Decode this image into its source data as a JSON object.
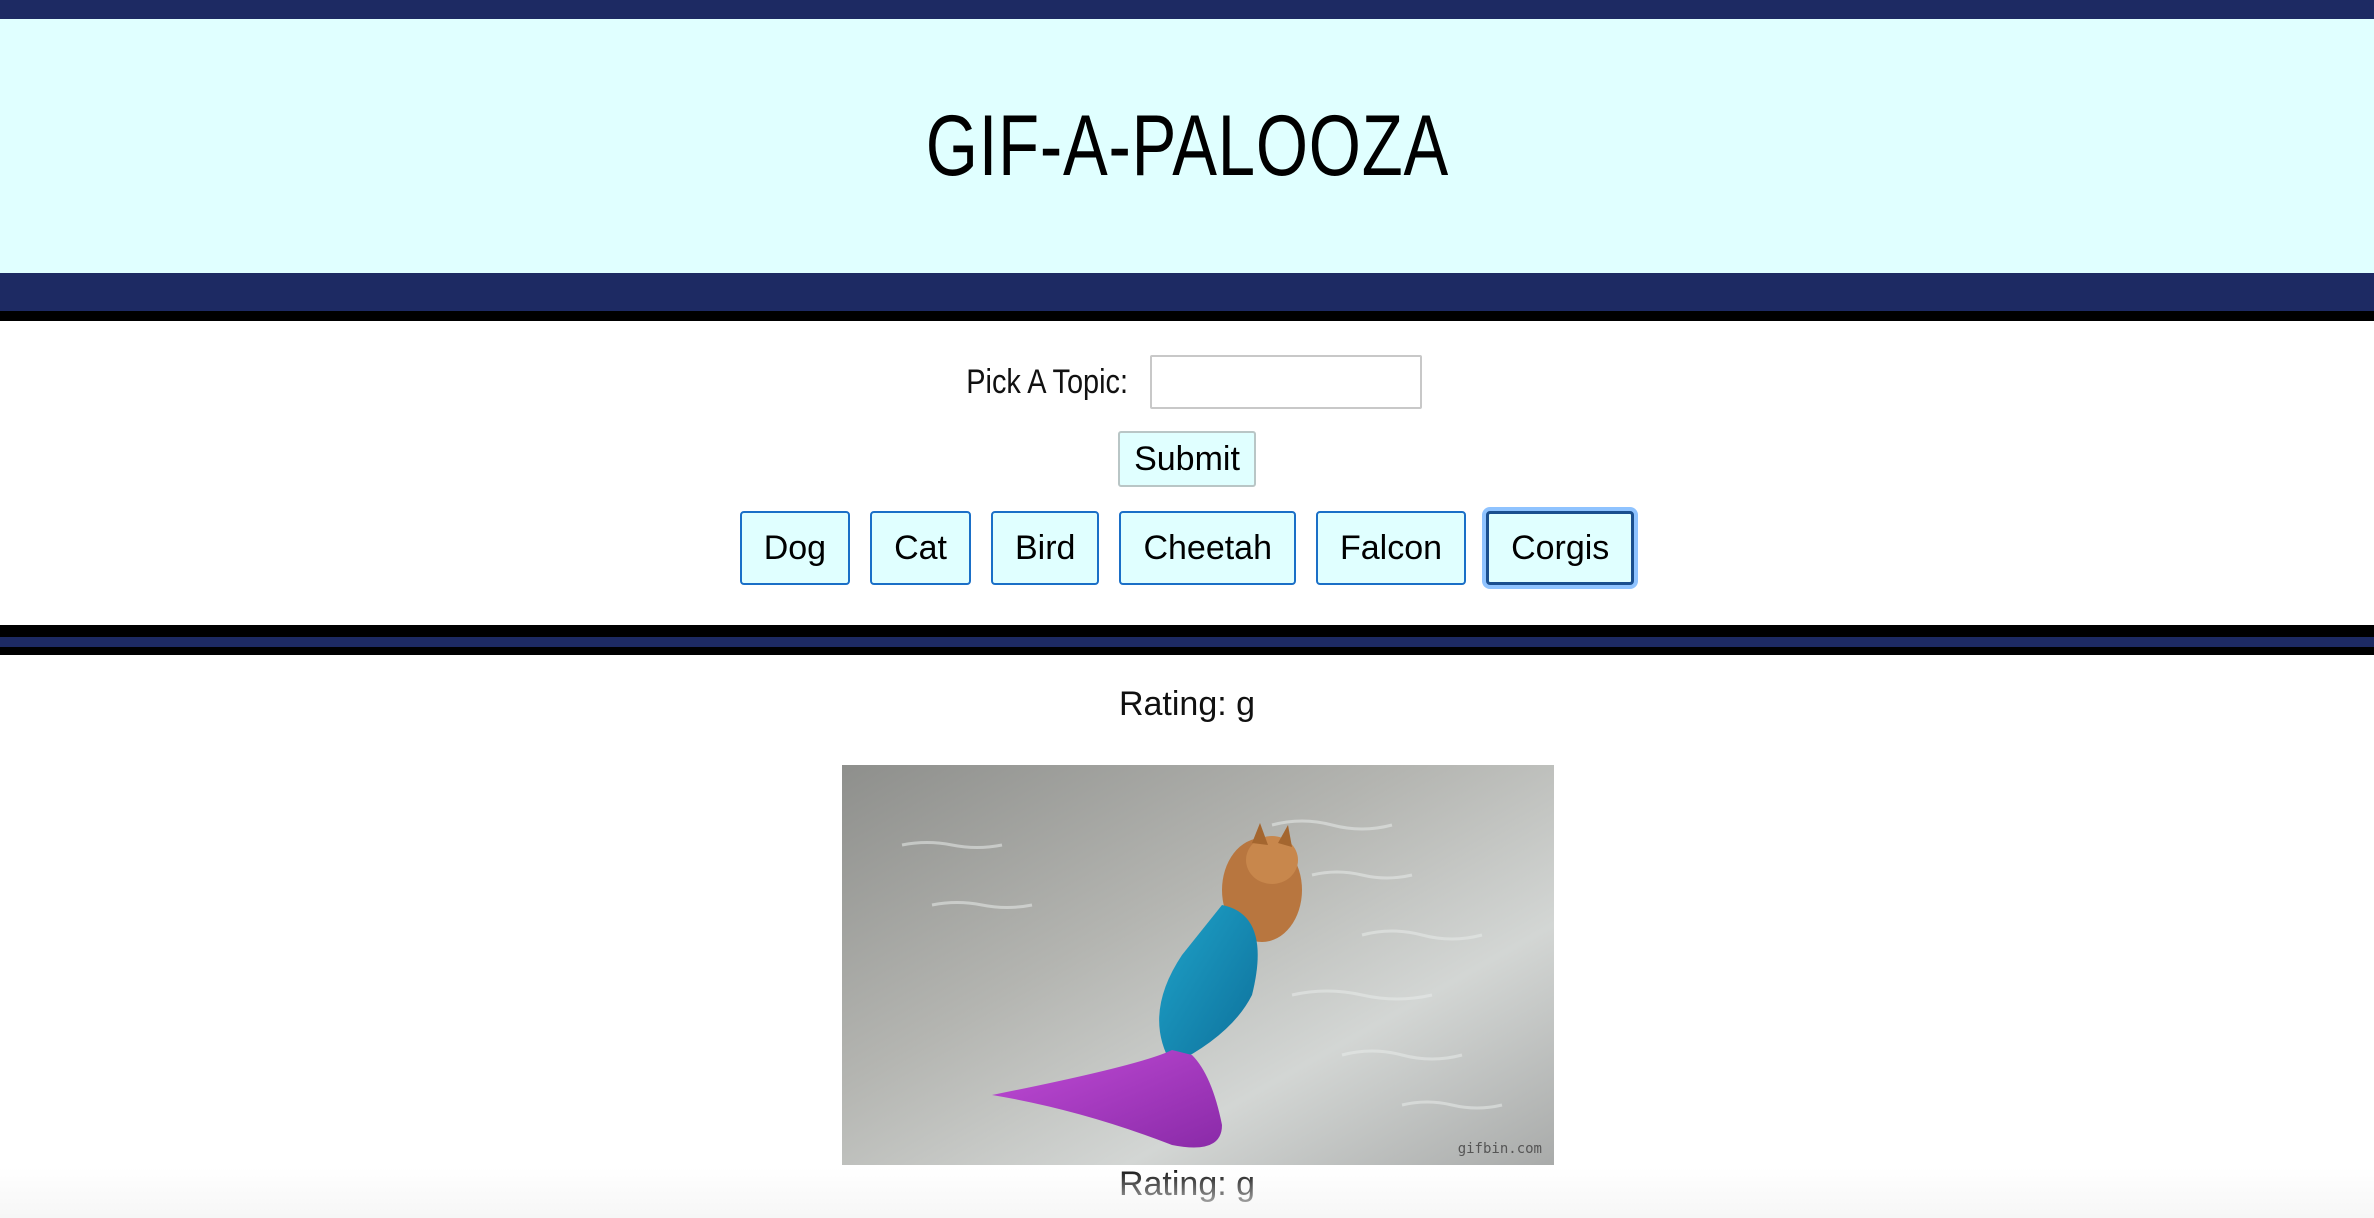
{
  "header": {
    "title": "GIF-A-PALOOZA"
  },
  "form": {
    "label": "Pick A Topic:",
    "input_value": "",
    "input_placeholder": "",
    "submit_label": "Submit"
  },
  "topics": [
    {
      "label": "Dog"
    },
    {
      "label": "Cat"
    },
    {
      "label": "Bird"
    },
    {
      "label": "Cheetah"
    },
    {
      "label": "Falcon"
    },
    {
      "label": "Corgis",
      "focused": true
    }
  ],
  "results": [
    {
      "rating": "Rating: g",
      "gif_subject": "corgi-mermaid-tail",
      "watermark": "gifbin.com"
    },
    {
      "rating": "Rating: g"
    }
  ],
  "colors": {
    "header_bg": "#e0ffff",
    "button_bg": "#e0ffff",
    "button_border": "#1a6fc7",
    "rule": "#000000"
  }
}
